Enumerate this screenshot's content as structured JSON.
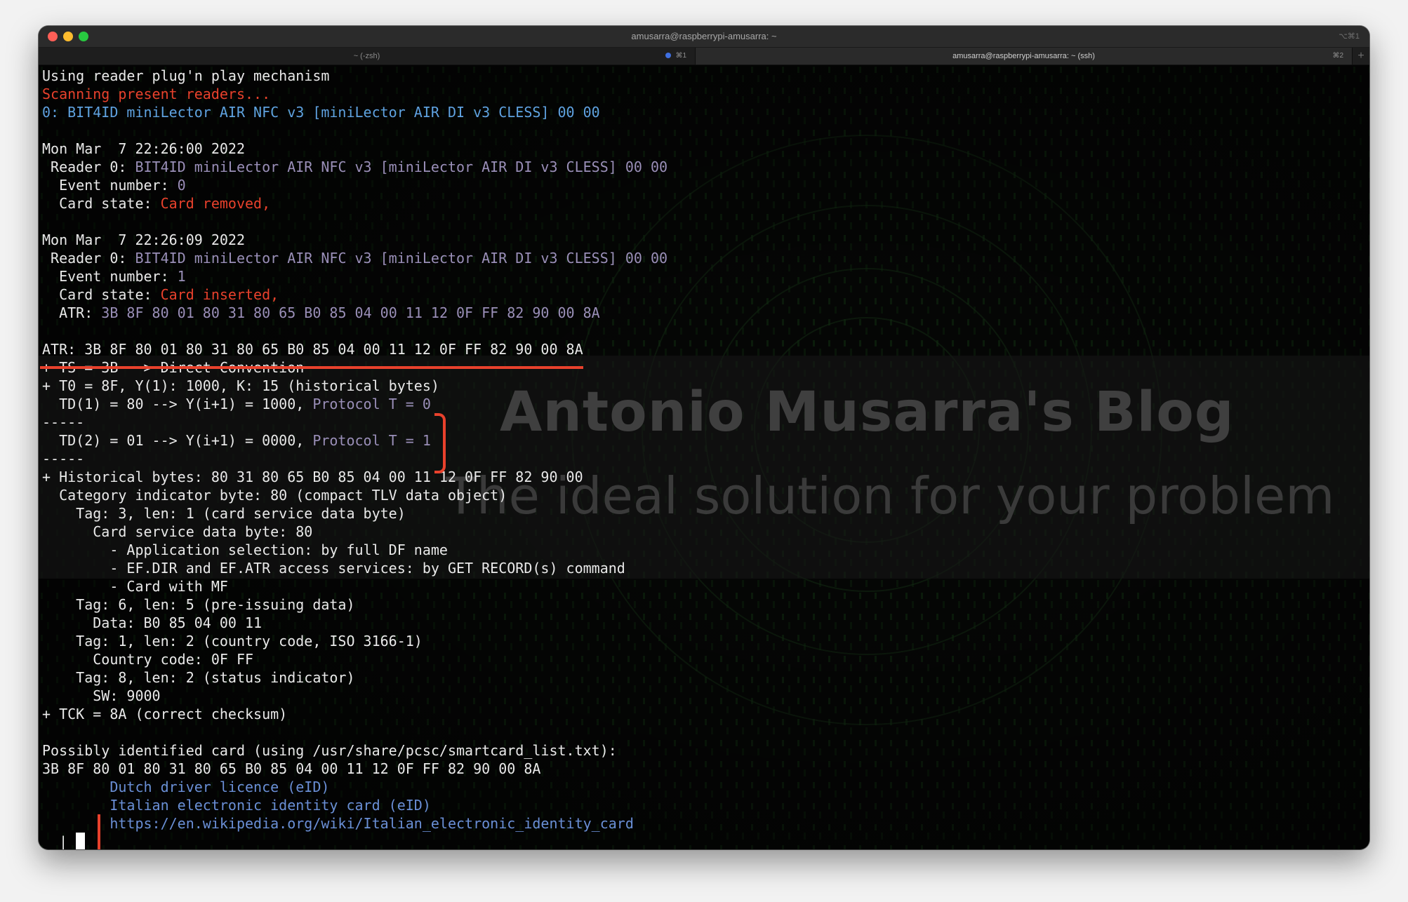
{
  "window": {
    "title": "amusarra@raspberrypi-amusarra: ~",
    "shortcut": "⌥⌘1"
  },
  "tabs": [
    {
      "label": "~ (-zsh)",
      "key": "⌘1",
      "active": false
    },
    {
      "label": "amusarra@raspberrypi-amusarra: ~ (ssh)",
      "key": "⌘2",
      "active": true
    }
  ],
  "watermark": {
    "title": "Antonio Musarra's Blog",
    "subtitle": "The ideal solution for your problem"
  },
  "terminal": {
    "l01": "Using reader plug'n play mechanism",
    "l02": "Scanning present readers...",
    "l03": "0: BIT4ID miniLector AIR NFC v3 [miniLector AIR DI v3 CLESS] 00 00",
    "l05": "Mon Mar  7 22:26:00 2022",
    "l06a": " Reader 0: ",
    "l06b": "BIT4ID miniLector AIR NFC v3 [miniLector AIR DI v3 CLESS] 00 00",
    "l07a": "  Event number: ",
    "l07b": "0",
    "l08a": "  Card state: ",
    "l08b": "Card removed,",
    "l10": "Mon Mar  7 22:26:09 2022",
    "l11a": " Reader 0: ",
    "l11b": "BIT4ID miniLector AIR NFC v3 [miniLector AIR DI v3 CLESS] 00 00",
    "l12a": "  Event number: ",
    "l12b": "1",
    "l13a": "  Card state: ",
    "l13b": "Card inserted,",
    "l14a": "  ATR: ",
    "l14b": "3B 8F 80 01 80 31 80 65 B0 85 04 00 11 12 0F FF 82 90 00 8A",
    "l16": "ATR: 3B 8F 80 01 80 31 80 65 B0 85 04 00 11 12 0F FF 82 90 00 8A",
    "l17": "+ TS = 3B --> Direct Convention",
    "l18": "+ T0 = 8F, Y(1): 1000, K: 15 (historical bytes)",
    "l19a": "  TD(1) = 80 --> Y(i+1) = 1000, ",
    "l19b": "Protocol T = 0",
    "l20": "-----",
    "l21a": "  TD(2) = 01 --> Y(i+1) = 0000, ",
    "l21b": "Protocol T = 1",
    "l22": "-----",
    "l23": "+ Historical bytes: 80 31 80 65 B0 85 04 00 11 12 0F FF 82 90 00",
    "l24": "  Category indicator byte: 80 (compact TLV data object)",
    "l25": "    Tag: 3, len: 1 (card service data byte)",
    "l26": "      Card service data byte: 80",
    "l27": "        - Application selection: by full DF name",
    "l28": "        - EF.DIR and EF.ATR access services: by GET RECORD(s) command",
    "l29": "        - Card with MF",
    "l30": "    Tag: 6, len: 5 (pre-issuing data)",
    "l31": "      Data: B0 85 04 00 11",
    "l32": "    Tag: 1, len: 2 (country code, ISO 3166-1)",
    "l33": "      Country code: 0F FF",
    "l34": "    Tag: 8, len: 2 (status indicator)",
    "l35": "      SW: 9000",
    "l36": "+ TCK = 8A (correct checksum)",
    "l38": "Possibly identified card (using /usr/share/pcsc/smartcard_list.txt):",
    "l39": "3B 8F 80 01 80 31 80 65 B0 85 04 00 11 12 0F FF 82 90 00 8A",
    "l40": "Dutch driver licence (eID)",
    "l41": "Italian electronic identity card (eID)",
    "l42": "https://en.wikipedia.org/wiki/Italian_electronic_identity_card",
    "prompt": "|"
  },
  "colors": {
    "accent_red": "#e8412c",
    "blue": "#5fa2e0",
    "gray": "#8f8f9a",
    "purple": "#9a8fb8",
    "text": "#e9e9e9",
    "background": "#060706"
  }
}
